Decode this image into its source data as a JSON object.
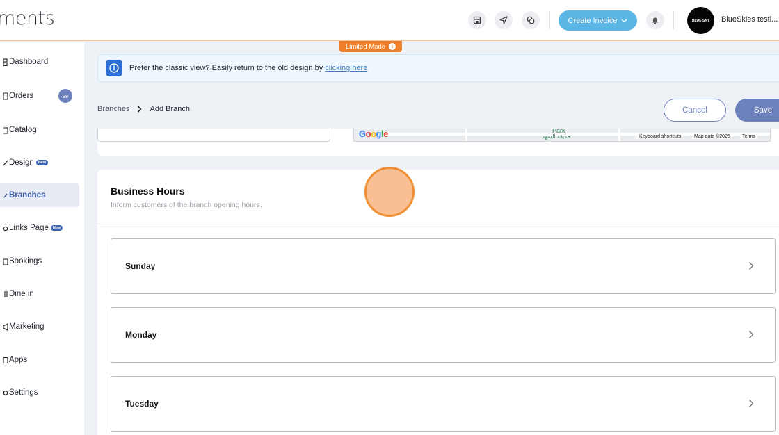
{
  "header": {
    "logo_text": "ments",
    "create_invoice_label": "Create Invoice",
    "avatar_text": "BLUE SKY",
    "username": "BlueSkies testi..."
  },
  "limited_mode": {
    "label": "Limited Mode"
  },
  "banner": {
    "message": "Prefer the classic view? Easily return to the old design by",
    "link_text": "clicking here"
  },
  "breadcrumb": {
    "parent": "Branches",
    "current": "Add Branch"
  },
  "actions": {
    "cancel": "Cancel",
    "save": "Save"
  },
  "sidebar": {
    "items": [
      {
        "label": "Dashboard",
        "icon": "dashboard-icon"
      },
      {
        "label": "Orders",
        "icon": "orders-icon",
        "count": "38"
      },
      {
        "label": "Catalog",
        "icon": "catalog-icon"
      },
      {
        "label": "Design",
        "icon": "design-icon",
        "badge": "New"
      },
      {
        "label": "Branches",
        "icon": "branches-icon",
        "active": true
      },
      {
        "label": "Links Page",
        "icon": "links-icon",
        "badge": "New"
      },
      {
        "label": "Bookings",
        "icon": "bookings-icon"
      },
      {
        "label": "Dine in",
        "icon": "dine-in-icon"
      },
      {
        "label": "Marketing",
        "icon": "marketing-icon"
      },
      {
        "label": "Apps",
        "icon": "apps-icon"
      },
      {
        "label": "Settings",
        "icon": "settings-icon"
      }
    ]
  },
  "map": {
    "logo": "Google",
    "park_label": "Park",
    "park_label_ar": "حديقة السهد",
    "keyboard_shortcuts": "Keyboard shortcuts",
    "map_data": "Map data ©2025",
    "terms": "Terms"
  },
  "business_hours": {
    "title": "Business Hours",
    "subtitle": "Inform customers of the branch opening hours.",
    "days": [
      "Sunday",
      "Monday",
      "Tuesday"
    ]
  },
  "colors": {
    "primary": "#6d82bd",
    "create_invoice": "#5bb5e5",
    "limited_mode": "#ef7f2a",
    "info_icon": "#2e6fd6"
  }
}
